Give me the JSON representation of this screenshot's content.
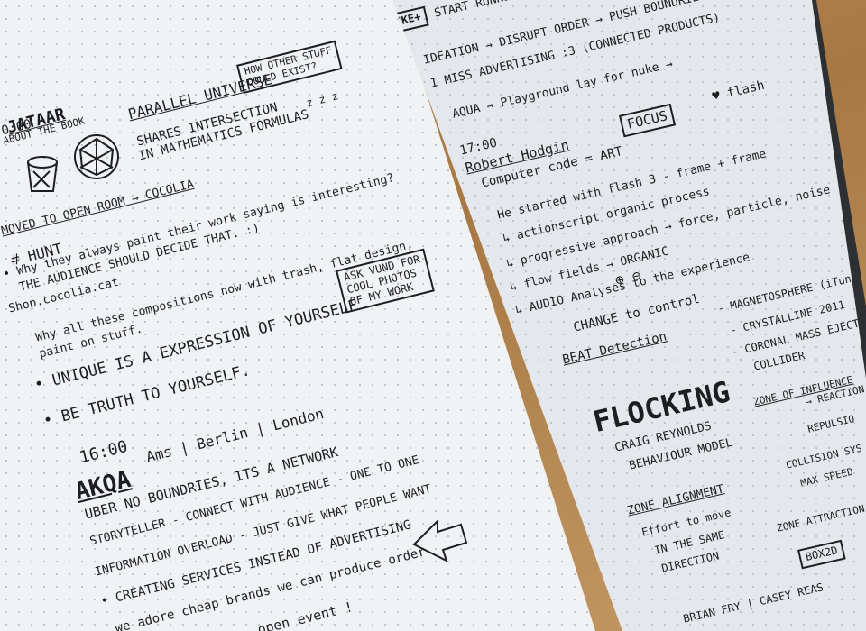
{
  "left_page": {
    "time_top": "0:00",
    "top_title": "JATAAR",
    "about_line": "ABOUT THE BOOK",
    "parallel": "PARALLEL UNIVERSE",
    "shares": "SHARES INTERSECTION",
    "formulas": "IN MATHEMATICS FORMULAS",
    "zzz": "z z z",
    "box_other": "HOW OTHER STUFF\nCOULD EXIST?",
    "moved_room": "MOVED TO OPEN ROOM → COCOLIA",
    "hunt": "# HUNT",
    "why_they": "• Why they always paint their work saying is interesting?",
    "audience": "THE AUDIENCE SHOULD DECIDE THAT. :)",
    "shop": "Shop.cocolia.cat",
    "compositions": "Why all these compositions now with trash, flat design,",
    "paint_stuff": "paint on stuff.",
    "ask_box": "ASK VUND FOR\nCOOL PHOTOS\nOF MY WORK",
    "unique": "• UNIQUE IS A EXPRESSION OF YOURSELF",
    "truth": "• BE TRUTH TO YOURSELF.",
    "time_1600": "16:00",
    "akqa": "AKQA",
    "ams": "Ams | Berlin | London",
    "uber": "UBER NO BOUNDRIES, ITS A NETWORK",
    "storyteller": "STORYTELLER - CONNECT WITH AUDIENCE - ONE TO ONE",
    "overload": "INFORMATION OVERLOAD - JUST GIVE WHAT PEOPLE WANT",
    "services": "• CREATING SERVICES INSTEAD OF ADVERTISING",
    "adore": "we adore cheap brands we can produce order",
    "open_event": "...ight → open event !"
  },
  "right_page": {
    "nike": "NIKE+",
    "start": "START RUNNING",
    "ideation": "IDEATION → DISRUPT ORDER → PUSH BOUNDRIES",
    "miss": "I MISS ADVERTISING :3 (CONNECTED PRODUCTS)",
    "aqua": "AQUA → Playground lay for nuke →",
    "time_1700": "17:00",
    "hodgin": "Robert Hodgin",
    "focus": "FOCUS",
    "flash": "♥ flash",
    "computer_code": "Computer code = ART",
    "started": "He started with flash 3 - frame + frame",
    "actionscript": "↳ actionscript organic process",
    "progressive": "↳ progressive approach → force, particle, noise",
    "flowfields": "↳ flow fields → ORGANIC",
    "audio": "↳ AUDIO Analyses to the experience",
    "plus_minus": "⊕   ⊖",
    "change": "CHANGE to control",
    "beat": "BEAT Detection",
    "magneto": "- MAGNETOSPHERE (iTunes)",
    "crystalline": "- CRYSTALLINE 2011",
    "coronal": "- CORONAL MASS EJECTION",
    "collider": "COLLIDER",
    "flocking": "FLOCKING",
    "craig": "CRAIG REYNOLDS",
    "behavior": "BEHAVIOUR MODEL",
    "zone_influence": "ZONE OF INFLUENCE",
    "repulsion": "→ REACTION",
    "repulsi": "REPULSIO",
    "collision": "COLLISION SYS",
    "max_speed": "MAX SPEED",
    "zone_alignment": "ZONE ALIGNMENT",
    "effort": "Effort to move",
    "same": "IN THE SAME",
    "direction": "DIRECTION",
    "zone_attraction": "ZONE ATTRACTION",
    "box2d": "BOX2D",
    "brian": "BRIAN FRY | CASEY REAS"
  },
  "colors": {
    "ink": "#1d1e22",
    "paper_left": "#f1f2f3",
    "paper_right": "#e4e8ec",
    "desk": "#b98a55",
    "cover_yellow": "#e9c628"
  },
  "icons": [
    "cup-sketch-icon",
    "web-sketch-icon",
    "left-arrow-sketch-icon",
    "heart-icon",
    "plus-icon",
    "minus-icon"
  ]
}
